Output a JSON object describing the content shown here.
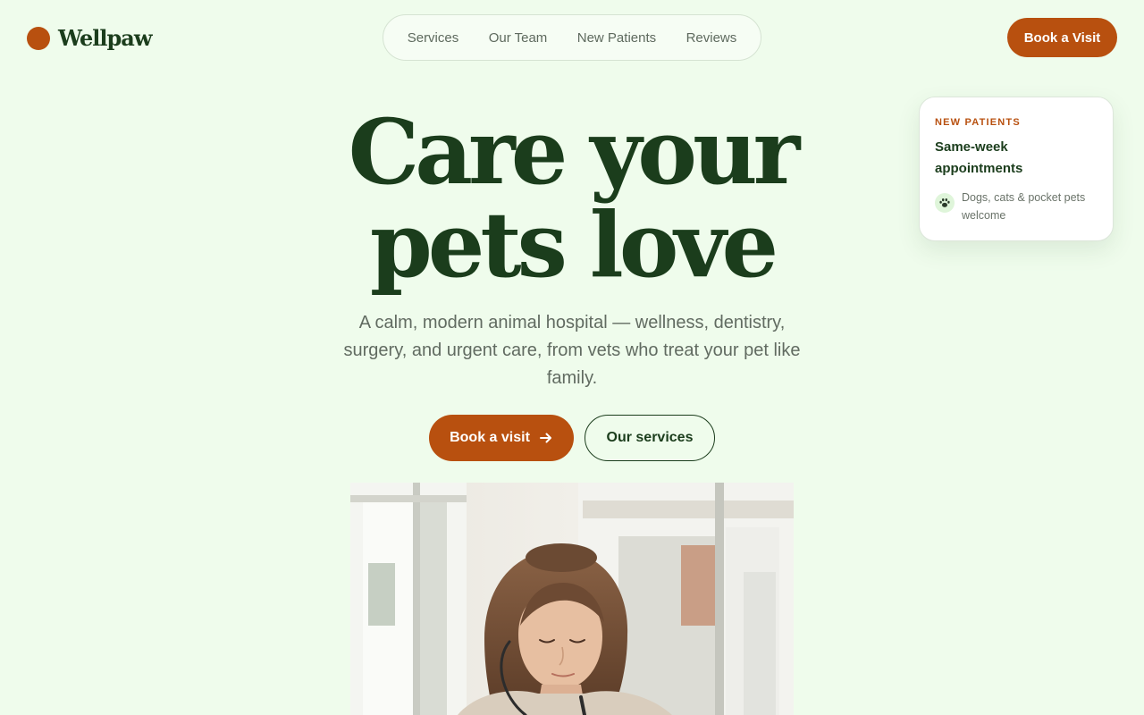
{
  "brand": {
    "name": "Wellpaw",
    "accent": "#b8500f",
    "ink": "#1b3d1c",
    "background": "#effcec"
  },
  "nav": {
    "items": [
      "Services",
      "Our Team",
      "New Patients",
      "Reviews"
    ]
  },
  "header": {
    "cta_label": "Book a Visit"
  },
  "hero": {
    "title_line1": "Care your",
    "title_line2": "pets love",
    "subtitle": "A calm, modern animal hospital — wellness, dentistry, surgery, and urgent care, from vets who treat your pet like family.",
    "primary_label": "Book a visit",
    "primary_icon": "arrow-right-icon",
    "secondary_label": "Our services"
  },
  "promo_card": {
    "eyebrow": "NEW PATIENTS",
    "title": "Same-week appointments",
    "icon": "paw-icon",
    "note": "Dogs, cats & pocket pets welcome"
  },
  "photo": {
    "subject": "veterinarian-with-stethoscope"
  }
}
